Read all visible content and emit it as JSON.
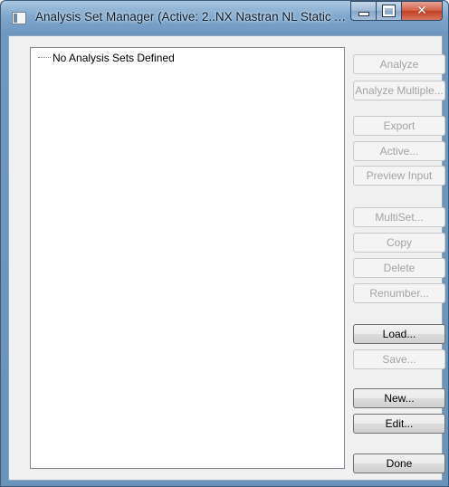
{
  "window": {
    "title": "Analysis Set Manager (Active: 2..NX Nastran NL Static Anal...",
    "caption_buttons": {
      "minimize": "minimize-icon",
      "maximize": "maximize-icon",
      "close": "✕"
    }
  },
  "tree": {
    "items": [
      {
        "label": "No Analysis Sets Defined"
      }
    ]
  },
  "buttons": {
    "analyze": {
      "label": "Analyze",
      "enabled": false
    },
    "analyze_multiple": {
      "label": "Analyze Multiple...",
      "enabled": false
    },
    "export": {
      "label": "Export",
      "enabled": false
    },
    "active": {
      "label": "Active...",
      "enabled": false
    },
    "preview_input": {
      "label": "Preview Input",
      "enabled": false
    },
    "multiset": {
      "label": "MultiSet...",
      "enabled": false
    },
    "copy": {
      "label": "Copy",
      "enabled": false
    },
    "delete": {
      "label": "Delete",
      "enabled": false
    },
    "renumber": {
      "label": "Renumber...",
      "enabled": false
    },
    "load": {
      "label": "Load...",
      "enabled": true
    },
    "save": {
      "label": "Save...",
      "enabled": false
    },
    "new": {
      "label": "New...",
      "enabled": true
    },
    "edit": {
      "label": "Edit...",
      "enabled": true
    },
    "done": {
      "label": "Done",
      "enabled": true
    }
  },
  "colors": {
    "titlebar": "#7fa7cc",
    "dialog_bg": "#f0f0f0",
    "close_button": "#c23f26",
    "disabled_text": "#a3a3a3"
  }
}
